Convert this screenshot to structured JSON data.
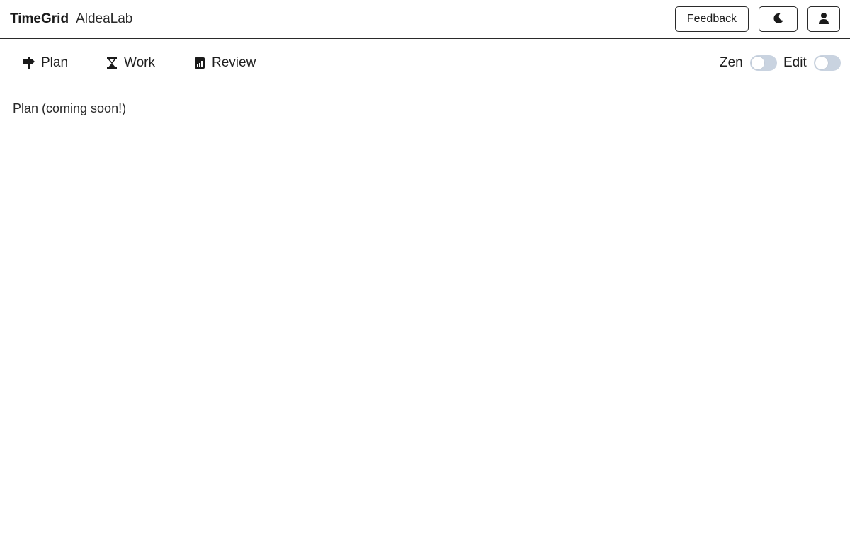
{
  "header": {
    "app_name": "TimeGrid",
    "org_name": "AldeaLab",
    "feedback_label": "Feedback",
    "theme_icon": "moon-icon",
    "account_icon": "person-icon"
  },
  "tabs": [
    {
      "label": "Plan",
      "icon": "signpost-icon"
    },
    {
      "label": "Work",
      "icon": "hourglass-icon"
    },
    {
      "label": "Review",
      "icon": "bar-chart-icon"
    }
  ],
  "toggles": {
    "zen": {
      "label": "Zen",
      "on": false
    },
    "edit": {
      "label": "Edit",
      "on": false
    }
  },
  "main": {
    "message": "Plan (coming soon!)"
  },
  "colors": {
    "toggle_off": "#c9d3e0",
    "border": "#2a2a2a",
    "text": "#1f1f1f"
  }
}
